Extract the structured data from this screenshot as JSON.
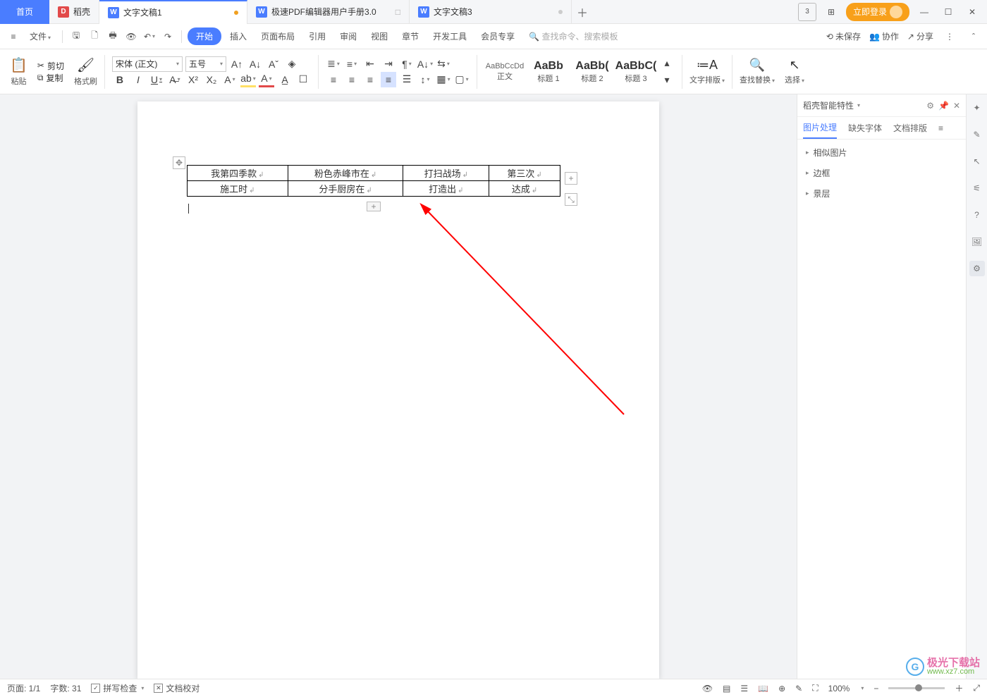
{
  "tabs": {
    "home": "首页",
    "daoke": "稻壳",
    "doc1": "文字文稿1",
    "pdf": "极速PDF编辑器用户手册3.0",
    "doc3": "文字文稿3"
  },
  "title_actions": {
    "login": "立即登录"
  },
  "file_menu": "文件",
  "menus": {
    "start": "开始",
    "insert": "插入",
    "layout": "页面布局",
    "ref": "引用",
    "review": "审阅",
    "view": "视图",
    "section": "章节",
    "dev": "开发工具",
    "member": "会员专享"
  },
  "search_placeholder": "查找命令、搜索模板",
  "right_actions": {
    "unsaved": "未保存",
    "collab": "协作",
    "share": "分享"
  },
  "ribbon": {
    "paste": "粘贴",
    "cut": "剪切",
    "copy": "复制",
    "format_painter": "格式刷",
    "font_name": "宋体 (正文)",
    "font_size": "五号",
    "styles": {
      "normal_sample": "AaBbCcDd",
      "normal": "正文",
      "h1_sample": "AaBb",
      "h1": "标题 1",
      "h2_sample": "AaBb(",
      "h2": "标题 2",
      "h3_sample": "AaBbC(",
      "h3": "标题 3"
    },
    "text_layout": "文字排版",
    "find_replace": "查找替换",
    "select": "选择"
  },
  "table": {
    "rows": [
      [
        "我第四季款",
        "粉色赤峰市在",
        "打扫战场",
        "第三次"
      ],
      [
        "施工时",
        "分手厨房在",
        "打造出",
        "达成"
      ]
    ]
  },
  "panel": {
    "title": "稻壳智能特性",
    "tabs": {
      "image": "图片处理",
      "missing_font": "缺失字体",
      "doc_layout": "文档排版"
    },
    "items": {
      "similar": "相似图片",
      "border": "边框",
      "layer": "景层"
    }
  },
  "status": {
    "page": "页面: 1/1",
    "words": "字数: 31",
    "spellcheck": "拼写检查",
    "proof": "文档校对",
    "zoom": "100%"
  },
  "watermark": {
    "cn": "极光下载站",
    "url": "www.xz7.com"
  }
}
